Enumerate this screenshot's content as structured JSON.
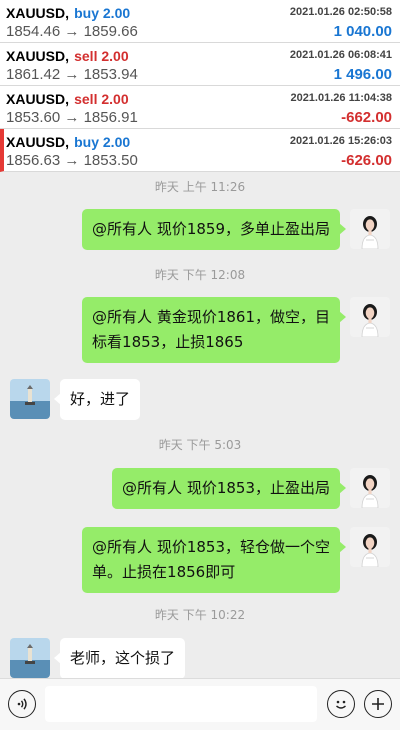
{
  "trades": [
    {
      "symbol": "XAUUSD,",
      "side": "buy 2.00",
      "side_type": "buy",
      "datetime": "2021.01.26 02:50:58",
      "open": "1854.46",
      "arrow": "→",
      "close": "1859.66",
      "profit": "1 040.00",
      "profit_type": "pos",
      "highlighted": false
    },
    {
      "symbol": "XAUUSD,",
      "side": "sell 2.00",
      "side_type": "sell",
      "datetime": "2021.01.26 06:08:41",
      "open": "1861.42",
      "arrow": "→",
      "close": "1853.94",
      "profit": "1 496.00",
      "profit_type": "pos",
      "highlighted": false
    },
    {
      "symbol": "XAUUSD,",
      "side": "sell 2.00",
      "side_type": "sell",
      "datetime": "2021.01.26 11:04:38",
      "open": "1853.60",
      "arrow": "→",
      "close": "1856.91",
      "profit": "-662.00",
      "profit_type": "neg",
      "highlighted": false
    },
    {
      "symbol": "XAUUSD,",
      "side": "buy 2.00",
      "side_type": "buy",
      "datetime": "2021.01.26 15:26:03",
      "open": "1856.63",
      "arrow": "→",
      "close": "1853.50",
      "profit": "-626.00",
      "profit_type": "neg",
      "highlighted": true
    }
  ],
  "chat": {
    "times": [
      "昨天 上午 11:26",
      "昨天 下午 12:08",
      "昨天 下午 5:03",
      "昨天 下午 10:22"
    ],
    "messages": [
      {
        "sender": "me",
        "text": "@所有人 现价1859，多单止盈出局"
      },
      {
        "sender": "me",
        "text_lines": [
          "@所有人 黄金现价1861，做空，目",
          "标看1853，止损1865"
        ]
      },
      {
        "sender": "other",
        "text": "好，进了"
      },
      {
        "sender": "me",
        "text": "@所有人 现价1853，止盈出局"
      },
      {
        "sender": "me",
        "text_lines": [
          "@所有人 现价1853，轻仓做一个空",
          "单。止损在1856即可"
        ]
      },
      {
        "sender": "other",
        "text": "老师，这个损了"
      }
    ]
  },
  "input_bar": {
    "voice_icon": "voice-icon",
    "emoji_icon": "emoji-icon",
    "plus_icon": "plus-icon",
    "input_value": ""
  },
  "colors": {
    "buy": "#1976d2",
    "sell": "#d32f2f",
    "my_bubble": "#95ec69",
    "chat_bg": "#ededed"
  }
}
